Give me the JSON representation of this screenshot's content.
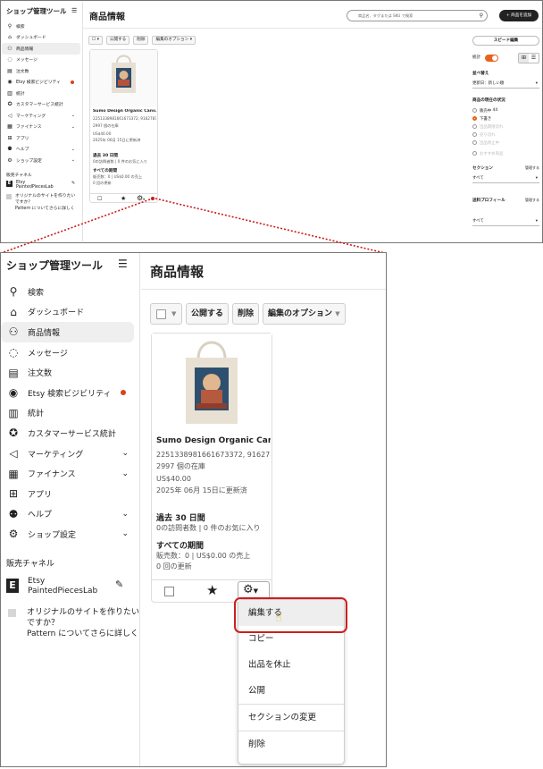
{
  "sidebar": {
    "brand": "ショップ管理ツール",
    "items": [
      {
        "label": "検索",
        "icon": "search-icon"
      },
      {
        "label": "ダッシュボード",
        "icon": "home-icon"
      },
      {
        "label": "商品情報",
        "icon": "products-icon"
      },
      {
        "label": "メッセージ",
        "icon": "message-icon"
      },
      {
        "label": "注文数",
        "icon": "orders-icon"
      },
      {
        "label": "Etsy 検索ビジビリティ",
        "icon": "search-visibility-icon"
      },
      {
        "label": "統計",
        "icon": "stats-icon"
      },
      {
        "label": "カスタマーサービス統計",
        "icon": "customer-service-icon"
      },
      {
        "label": "マーケティング",
        "icon": "megaphone-icon"
      },
      {
        "label": "ファイナンス",
        "icon": "finance-icon"
      },
      {
        "label": "アプリ",
        "icon": "apps-icon"
      },
      {
        "label": "ヘルプ",
        "icon": "help-icon"
      },
      {
        "label": "ショップ設定",
        "icon": "settings-icon"
      }
    ],
    "sales_channel_title": "販売チャネル",
    "etsy_name": "Etsy",
    "shop_name": "PaintedPiecesLab",
    "other_site_line1": "オリジナルのサイトを作りたい",
    "other_site_line2": "ですか？",
    "other_site_line3": "Pattern についてさらに詳しく",
    "accent_dot_color": "#d9421a"
  },
  "header": {
    "title": "商品情報",
    "search_placeholder": "商品名、タグまたは SKU で検索",
    "add_button": "商品を追加"
  },
  "toolbar": {
    "publish": "公開する",
    "delete": "削除",
    "edit_options": "編集のオプション"
  },
  "card": {
    "title": "Sumo Design Organic Canv...",
    "ids": "2251338981661673372, 9162787...",
    "stock": "2997 個の在庫",
    "price": "US$40.00",
    "updated": "2025年 06月 15日に更新済",
    "last30_title": "過去 30 日間",
    "last30_stats": "0の訪問者数 | 0 件のお気に入り",
    "all_time_title": "すべての期間",
    "all_time_stats": "販売数：0 | US$0.00 の売上",
    "renewals": "0 回の更新"
  },
  "gear_menu": {
    "items": [
      "編集する",
      "コピー",
      "出品を休止",
      "公開",
      "セクションの変更",
      "削除"
    ]
  },
  "right_panel": {
    "speed_edit": "スピード編集",
    "stats_label": "統計",
    "sort_label": "並べ替え",
    "sort_value": "更新日：新しい順",
    "status_title": "商品の現在の状況",
    "status_active": "販売中",
    "status_active_count": "44",
    "status_draft": "下書き",
    "status_expired": "出品期限切れ",
    "status_sold_out": "売り切れ",
    "status_inactive": "出品停止中",
    "status_featured": "おすすめ商品",
    "section_label": "セクション",
    "section_manage": "管理する",
    "section_value": "すべて",
    "shipping_label": "送料プロフィール",
    "shipping_manage": "管理する",
    "shipping_value": "すべて",
    "toggle_color": "#e8631a"
  },
  "colors": {
    "highlight_border": "#cf1d1d",
    "connector": "#cc1a1a"
  }
}
